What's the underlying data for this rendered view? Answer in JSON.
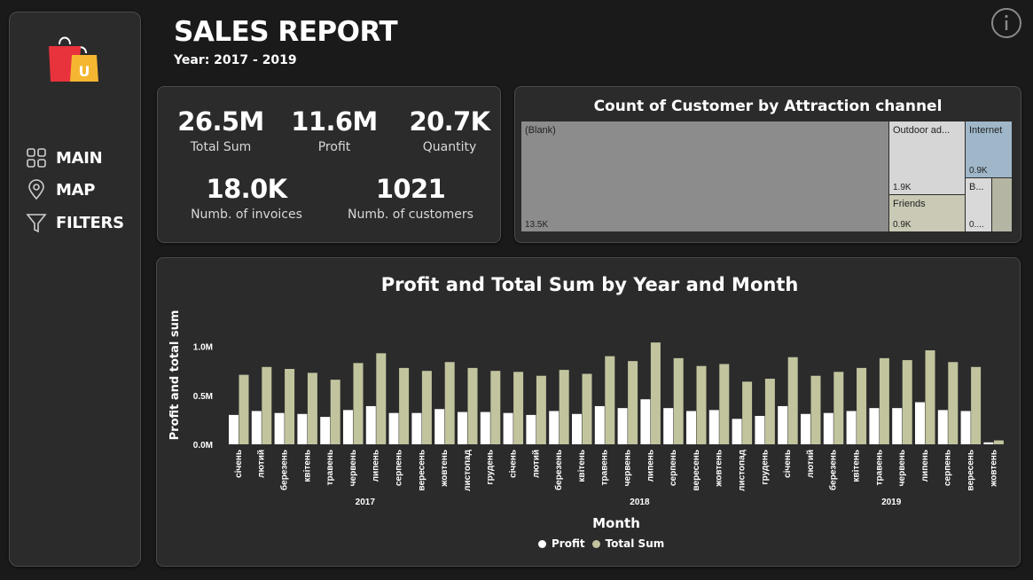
{
  "header": {
    "title": "SALES REPORT",
    "year_range": "Year: 2017 - 2019"
  },
  "nav": {
    "items": [
      {
        "label": "MAIN",
        "icon": "grid-icon"
      },
      {
        "label": "MAP",
        "icon": "map-pin-icon"
      },
      {
        "label": "FILTERS",
        "icon": "filter-icon"
      }
    ]
  },
  "kpis": {
    "total_sum": {
      "value": "26.5M",
      "label": "Total Sum"
    },
    "profit": {
      "value": "11.6M",
      "label": "Profit"
    },
    "quantity": {
      "value": "20.7K",
      "label": "Quantity"
    },
    "invoices": {
      "value": "18.0K",
      "label": "Numb. of invoices"
    },
    "customers": {
      "value": "1021",
      "label": "Numb. of customers"
    }
  },
  "treemap": {
    "title": "Count of Customer by Attraction channel",
    "tiles": [
      {
        "label": "(Blank)",
        "value": "13.5K",
        "color": "#8c8c8c"
      },
      {
        "label": "Outdoor ad...",
        "value": "1.9K",
        "color": "#d6d6d6"
      },
      {
        "label": "Internet",
        "value": "0.9K",
        "color": "#9fb7c9"
      },
      {
        "label": "Friends",
        "value": "0.9K",
        "color": "#c9c9b5"
      },
      {
        "label": "B...",
        "value": "0....",
        "color": "#d9d9d9"
      },
      {
        "label": "",
        "value": "",
        "color": "#b5b5a4"
      }
    ]
  },
  "chart_data": {
    "type": "bar",
    "title": "Profit and Total Sum by Year and Month",
    "xlabel": "Month",
    "ylabel": "Profit and total sum",
    "ylim": [
      0,
      1.25
    ],
    "yticks": [
      "0.0M",
      "0.5M",
      "1.0M"
    ],
    "ytick_values": [
      0,
      0.5,
      1.0
    ],
    "categories": [
      "січень",
      "лютий",
      "березень",
      "квітень",
      "травень",
      "червень",
      "липень",
      "серпень",
      "вересень",
      "жовтень",
      "листопад",
      "грудень",
      "січень",
      "лютий",
      "березень",
      "квітень",
      "травень",
      "червень",
      "липень",
      "серпень",
      "вересень",
      "жовтень",
      "листопад",
      "грудень",
      "січень",
      "лютий",
      "березень",
      "квітень",
      "травень",
      "червень",
      "липень",
      "серпень",
      "вересень",
      "жовтень"
    ],
    "year_groups": [
      {
        "label": "2017",
        "count": 12
      },
      {
        "label": "2018",
        "count": 12
      },
      {
        "label": "2019",
        "count": 10
      }
    ],
    "series": [
      {
        "name": "Profit",
        "color": "#ffffff",
        "values": [
          0.3,
          0.34,
          0.32,
          0.31,
          0.28,
          0.35,
          0.39,
          0.32,
          0.32,
          0.36,
          0.33,
          0.33,
          0.32,
          0.3,
          0.34,
          0.31,
          0.39,
          0.37,
          0.46,
          0.37,
          0.34,
          0.35,
          0.26,
          0.29,
          0.39,
          0.31,
          0.32,
          0.34,
          0.37,
          0.37,
          0.43,
          0.35,
          0.34,
          0.02
        ]
      },
      {
        "name": "Total Sum",
        "color": "#c2c49e",
        "values": [
          0.71,
          0.79,
          0.77,
          0.73,
          0.66,
          0.83,
          0.93,
          0.78,
          0.75,
          0.84,
          0.78,
          0.75,
          0.74,
          0.7,
          0.76,
          0.72,
          0.9,
          0.85,
          1.04,
          0.88,
          0.8,
          0.82,
          0.64,
          0.67,
          0.89,
          0.7,
          0.74,
          0.78,
          0.88,
          0.86,
          0.96,
          0.84,
          0.79,
          0.04
        ]
      }
    ],
    "legend_position": "bottom",
    "grid": false
  }
}
